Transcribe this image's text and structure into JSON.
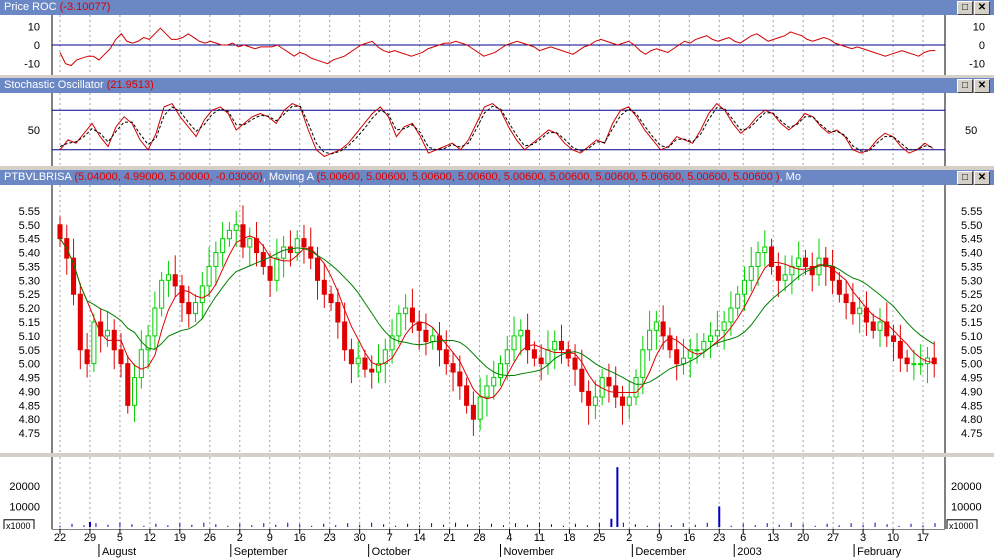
{
  "panels": {
    "roc": {
      "title": "Price ROC",
      "value": "(-3.10077)"
    },
    "stoch": {
      "title": "Stochastic Oscillator",
      "value": "(21.9513)"
    },
    "main": {
      "title": "PTBVLBRISA",
      "value": "(5.04000, 4.99000, 5.00000, -0.03000)",
      "ma_label": ", Moving A",
      "ma_value": "(5.00600, 5.00600, 5.00600, 5.00600, 5.00600, 5.00600, 5.00600, 5.00600, 5.00600, 5.00600 )",
      "trail": ", Mo"
    },
    "volume": {
      "multiplier": "x1000"
    }
  },
  "buttons": {
    "restore": "□",
    "close": "✕"
  },
  "chart_data": [
    {
      "type": "line",
      "name": "Price ROC",
      "y_ticks": [
        -10,
        0,
        10
      ],
      "ylim": [
        -15,
        15
      ],
      "reference_line": 0,
      "values": [
        -4,
        -10,
        -11,
        -8,
        -7,
        -6,
        -6,
        -8,
        -5,
        -2,
        3,
        6,
        2,
        1,
        2,
        4,
        3,
        6,
        9,
        6,
        3,
        3,
        4,
        6,
        4,
        2,
        1,
        2,
        1,
        0,
        0,
        1,
        -1,
        0,
        -1,
        -2,
        -1,
        -1,
        -1,
        0,
        -2,
        -4,
        -6,
        -4,
        -5,
        -7,
        -8,
        -9,
        -10,
        -8,
        -7,
        -6,
        -4,
        -2,
        0,
        1,
        2,
        -1,
        -3,
        -4,
        -3,
        -4,
        -5,
        -6,
        -5,
        -4,
        -2,
        -1,
        0,
        1,
        1,
        2,
        1,
        0,
        -2,
        -4,
        -6,
        -5,
        -4,
        -2,
        0,
        1,
        2,
        1,
        0,
        -1,
        -3,
        -2,
        -1,
        -2,
        -3,
        -4,
        -5,
        -3,
        -1,
        0,
        2,
        3,
        2,
        1,
        0,
        1,
        2,
        0,
        -3,
        -5,
        -3,
        -2,
        -3,
        -4,
        -2,
        0,
        2,
        1,
        3,
        4,
        5,
        3,
        2,
        3,
        4,
        2,
        1,
        3,
        5,
        6,
        4,
        2,
        3,
        4,
        5,
        7,
        6,
        5,
        3,
        2,
        3,
        4,
        3,
        1,
        0,
        -1,
        -2,
        -1,
        -2,
        -3,
        -4,
        -5,
        -6,
        -5,
        -4,
        -3,
        -4,
        -5,
        -6,
        -4,
        -3,
        -3
      ]
    },
    {
      "type": "line",
      "name": "Stochastic Oscillator",
      "y_ticks": [
        50
      ],
      "ylim": [
        0,
        100
      ],
      "reference_lines": [
        20,
        80
      ],
      "series": [
        {
          "values": [
            20,
            35,
            30,
            45,
            60,
            40,
            25,
            55,
            70,
            60,
            35,
            20,
            45,
            85,
            90,
            70,
            55,
            40,
            65,
            80,
            85,
            75,
            50,
            60,
            70,
            75,
            70,
            60,
            80,
            90,
            85,
            50,
            20,
            10,
            15,
            20,
            30,
            45,
            60,
            75,
            85,
            70,
            40,
            55,
            60,
            40,
            15,
            20,
            25,
            30,
            20,
            35,
            60,
            85,
            90,
            80,
            55,
            35,
            20,
            30,
            40,
            50,
            45,
            30,
            20,
            15,
            25,
            35,
            30,
            60,
            80,
            85,
            70,
            50,
            35,
            20,
            25,
            40,
            35,
            30,
            50,
            75,
            90,
            80,
            60,
            45,
            55,
            70,
            80,
            75,
            60,
            50,
            60,
            75,
            70,
            55,
            45,
            50,
            40,
            20,
            15,
            20,
            35,
            45,
            40,
            25,
            15,
            20,
            30,
            22
          ]
        },
        {
          "values": [
            25,
            30,
            32,
            40,
            52,
            45,
            32,
            48,
            62,
            62,
            44,
            28,
            38,
            72,
            85,
            78,
            62,
            48,
            58,
            74,
            82,
            78,
            58,
            58,
            66,
            72,
            71,
            64,
            74,
            86,
            86,
            60,
            30,
            16,
            14,
            18,
            26,
            38,
            52,
            68,
            80,
            74,
            50,
            52,
            58,
            46,
            24,
            20,
            22,
            28,
            24,
            30,
            52,
            76,
            86,
            82,
            62,
            42,
            26,
            28,
            36,
            46,
            46,
            36,
            24,
            18,
            22,
            32,
            31,
            52,
            72,
            82,
            74,
            56,
            40,
            26,
            24,
            36,
            36,
            32,
            44,
            66,
            84,
            82,
            66,
            50,
            52,
            64,
            76,
            76,
            64,
            54,
            58,
            70,
            70,
            58,
            48,
            48,
            42,
            26,
            18,
            18,
            30,
            40,
            40,
            30,
            20,
            20,
            26,
            24
          ]
        }
      ]
    },
    {
      "type": "candlestick",
      "name": "PTBVLBRISA",
      "y_ticks": [
        4.75,
        4.8,
        4.85,
        4.9,
        4.95,
        5.0,
        5.05,
        5.1,
        5.15,
        5.2,
        5.25,
        5.3,
        5.35,
        5.4,
        5.45,
        5.5,
        5.55
      ],
      "ylim": [
        4.7,
        5.6
      ],
      "closes": [
        5.45,
        5.38,
        5.25,
        5.05,
        5.0,
        5.15,
        5.1,
        5.12,
        5.05,
        5.0,
        4.85,
        4.95,
        5.05,
        5.1,
        5.2,
        5.3,
        5.32,
        5.28,
        5.22,
        5.18,
        5.22,
        5.28,
        5.35,
        5.4,
        5.45,
        5.48,
        5.5,
        5.42,
        5.45,
        5.4,
        5.35,
        5.3,
        5.38,
        5.42,
        5.4,
        5.45,
        5.42,
        5.38,
        5.3,
        5.25,
        5.22,
        5.15,
        5.05,
        5.0,
        5.02,
        4.98,
        4.97,
        5.0,
        5.05,
        5.1,
        5.18,
        5.2,
        5.15,
        5.12,
        5.08,
        5.1,
        5.05,
        5.0,
        4.97,
        4.92,
        4.85,
        4.8,
        4.88,
        4.92,
        4.95,
        5.0,
        5.05,
        5.1,
        5.12,
        5.05,
        5.02,
        5.0,
        5.05,
        5.08,
        5.05,
        5.02,
        4.98,
        4.9,
        4.85,
        4.88,
        4.95,
        4.92,
        4.88,
        4.85,
        4.88,
        4.95,
        5.05,
        5.12,
        5.15,
        5.1,
        5.05,
        5.0,
        5.02,
        5.05,
        5.05,
        5.08,
        5.1,
        5.12,
        5.15,
        5.2,
        5.25,
        5.3,
        5.35,
        5.4,
        5.42,
        5.35,
        5.3,
        5.32,
        5.35,
        5.38,
        5.35,
        5.32,
        5.38,
        5.35,
        5.3,
        5.25,
        5.22,
        5.18,
        5.2,
        5.15,
        5.12,
        5.15,
        5.1,
        5.08,
        5.02,
        5.0,
        5.0,
        5.0,
        5.02,
        5.0
      ]
    },
    {
      "type": "bar",
      "name": "Volume",
      "y_ticks": [
        10000,
        20000
      ],
      "ylim": [
        0,
        32000
      ],
      "x_labels": [
        {
          "label": "22",
          "pos": 0
        },
        {
          "label": "29",
          "pos": 5
        },
        {
          "label": "5",
          "pos": 10
        },
        {
          "label": "12",
          "pos": 15
        },
        {
          "label": "19",
          "pos": 20
        },
        {
          "label": "26",
          "pos": 25
        },
        {
          "label": "2",
          "pos": 30
        },
        {
          "label": "9",
          "pos": 35
        },
        {
          "label": "16",
          "pos": 40
        },
        {
          "label": "23",
          "pos": 45
        },
        {
          "label": "30",
          "pos": 50
        },
        {
          "label": "7",
          "pos": 55
        },
        {
          "label": "14",
          "pos": 60
        },
        {
          "label": "21",
          "pos": 65
        },
        {
          "label": "28",
          "pos": 70
        },
        {
          "label": "4",
          "pos": 75
        },
        {
          "label": "11",
          "pos": 80
        },
        {
          "label": "18",
          "pos": 85
        },
        {
          "label": "25",
          "pos": 90
        },
        {
          "label": "2",
          "pos": 95
        },
        {
          "label": "9",
          "pos": 100
        },
        {
          "label": "16",
          "pos": 105
        },
        {
          "label": "23",
          "pos": 110
        },
        {
          "label": "6",
          "pos": 114
        },
        {
          "label": "13",
          "pos": 119
        },
        {
          "label": "20",
          "pos": 124
        },
        {
          "label": "27",
          "pos": 129
        },
        {
          "label": "3",
          "pos": 134
        },
        {
          "label": "10",
          "pos": 139
        },
        {
          "label": "17",
          "pos": 144
        }
      ],
      "month_labels": [
        {
          "label": "August",
          "pos": 7
        },
        {
          "label": "September",
          "pos": 29
        },
        {
          "label": "October",
          "pos": 52
        },
        {
          "label": "November",
          "pos": 74
        },
        {
          "label": "December",
          "pos": 96
        },
        {
          "label": "2003",
          "pos": 113
        },
        {
          "label": "February",
          "pos": 133
        }
      ],
      "spikes": [
        {
          "pos": 93,
          "value": 29000
        },
        {
          "pos": 110,
          "value": 10000
        },
        {
          "pos": 92,
          "value": 4000
        },
        {
          "pos": 5,
          "value": 2500
        }
      ]
    }
  ]
}
